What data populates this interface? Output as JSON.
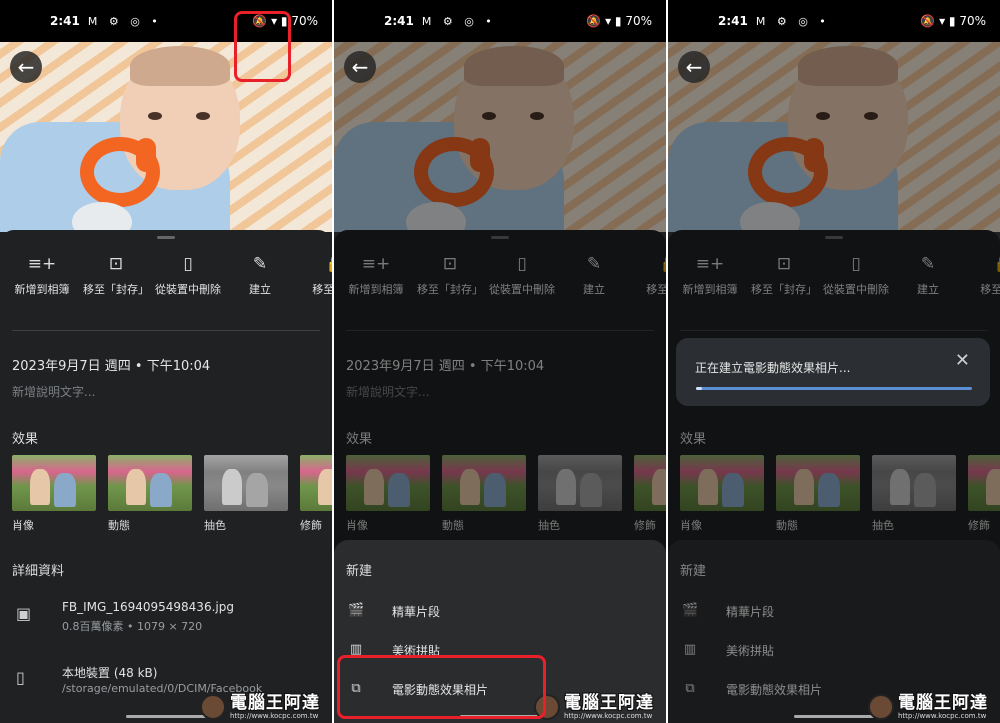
{
  "status": {
    "time": "2:41",
    "icons": "M ⚙ ◎ •",
    "right": "🔕 ▾ ▮ 70%"
  },
  "actions": [
    {
      "label": "新增到相簿",
      "icon": "playlist-add-icon",
      "glyph": "≡+"
    },
    {
      "label": "移至「封存」",
      "icon": "archive-icon",
      "glyph": "⊡"
    },
    {
      "label": "從裝置中刪除",
      "icon": "device-delete-icon",
      "glyph": "▯"
    },
    {
      "label": "建立",
      "icon": "brush-icon",
      "glyph": "✎"
    },
    {
      "label": "移至 的資",
      "icon": "lock-icon",
      "glyph": "🔒"
    }
  ],
  "photo_info": {
    "date": "2023年9月7日 週四 • 下午10:04",
    "description_placeholder": "新增說明文字..."
  },
  "effects": {
    "title": "效果",
    "items": [
      "肖像",
      "動態",
      "抽色",
      "修飾"
    ]
  },
  "details": {
    "title": "詳細資料",
    "file_name": "FB_IMG_1694095498436.jpg",
    "file_meta": "0.8百萬像素 • 1079 × 720",
    "storage_name": "本地裝置 (48 kB)",
    "storage_path": "/storage/emulated/0/DCIM/Facebook"
  },
  "create_menu": {
    "title": "新建",
    "items": [
      {
        "label": "精華片段",
        "icon": "clapperboard-icon",
        "glyph": "🎬"
      },
      {
        "label": "美術拼貼",
        "icon": "collage-icon",
        "glyph": "▥"
      },
      {
        "label": "電影動態效果相片",
        "icon": "cinematic-icon",
        "glyph": "⧉"
      }
    ]
  },
  "toast": {
    "text": "正在建立電影動態效果相片...",
    "progress": 0.02
  },
  "watermark": {
    "name": "電腦王阿達",
    "url": "http://www.kocpc.com.tw"
  },
  "colors": {
    "highlight": "#e8202a",
    "progress": "#5b8fd4"
  }
}
